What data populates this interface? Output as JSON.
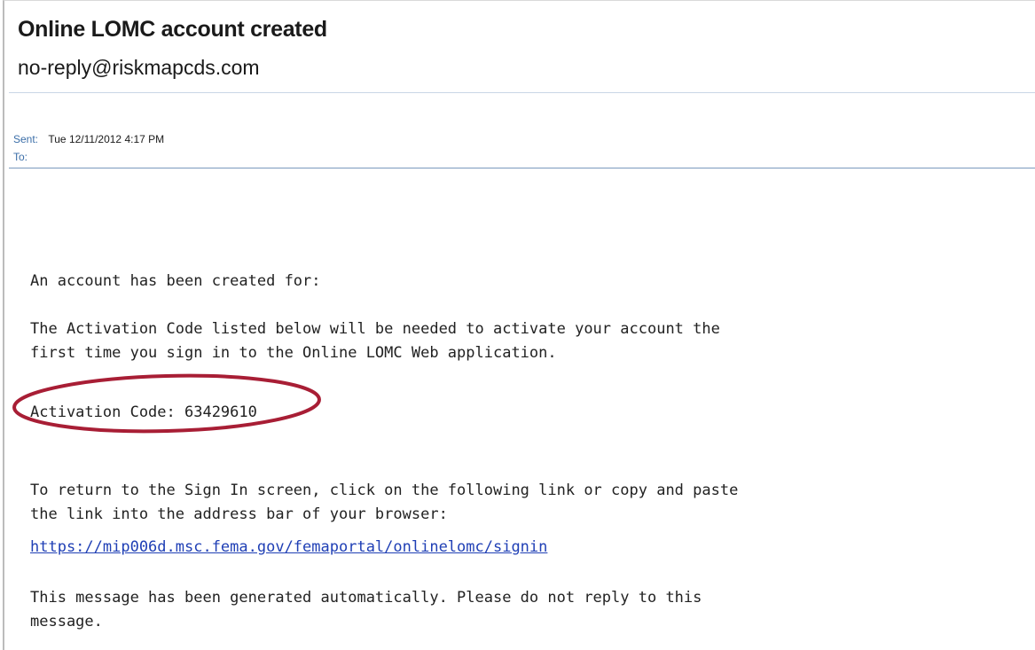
{
  "email": {
    "subject": "Online LOMC account created",
    "sender": "no-reply@riskmapcds.com",
    "sent_label": "Sent:",
    "sent_value": "Tue 12/11/2012 4:17 PM",
    "to_label": "To:",
    "to_value": ""
  },
  "body": {
    "line1": "An account has been created for:",
    "para2": "The Activation Code listed below will be needed to activate your account the\nfirst time you sign in to the Online LOMC Web application.",
    "activation": "Activation Code: 63429610",
    "para4": "To return to the Sign In screen, click on the following link or copy and paste\nthe link into the address bar of your browser:",
    "link": "https://mip006d.msc.fema.gov/femaportal/onlinelomc/signin",
    "para6": "This message has been generated automatically. Please do not reply to this\nmessage."
  },
  "annotation": {
    "ellipse_color": "#a81e35"
  }
}
